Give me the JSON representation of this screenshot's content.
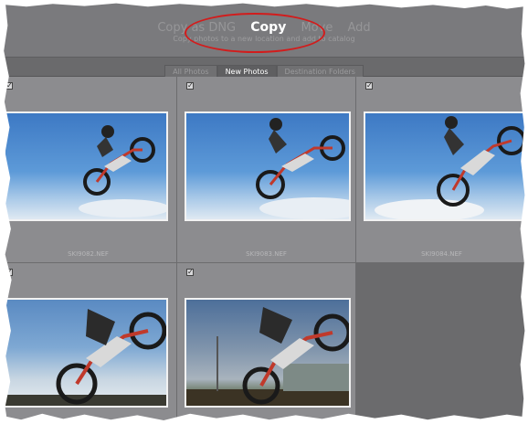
{
  "header": {
    "modes": [
      "Copy as DNG",
      "Copy",
      "Move",
      "Add"
    ],
    "active_mode": "Copy",
    "subtitle": "Copy photos to a new location and add to catalog"
  },
  "tabs": [
    {
      "label": "All Photos",
      "active": false
    },
    {
      "label": "New Photos",
      "active": true
    },
    {
      "label": "Destination Folders",
      "active": false
    }
  ],
  "photos": [
    {
      "filename": "SKI9082.NEF",
      "checked": true
    },
    {
      "filename": "SKI9083.NEF",
      "checked": true
    },
    {
      "filename": "SKI9084.NEF",
      "checked": true
    },
    {
      "filename": "",
      "checked": true
    },
    {
      "filename": "",
      "checked": true
    }
  ],
  "colors": {
    "annotation": "#d21c1c",
    "panel": "#7a7a7d",
    "grid_cell": "#8c8c8f"
  }
}
